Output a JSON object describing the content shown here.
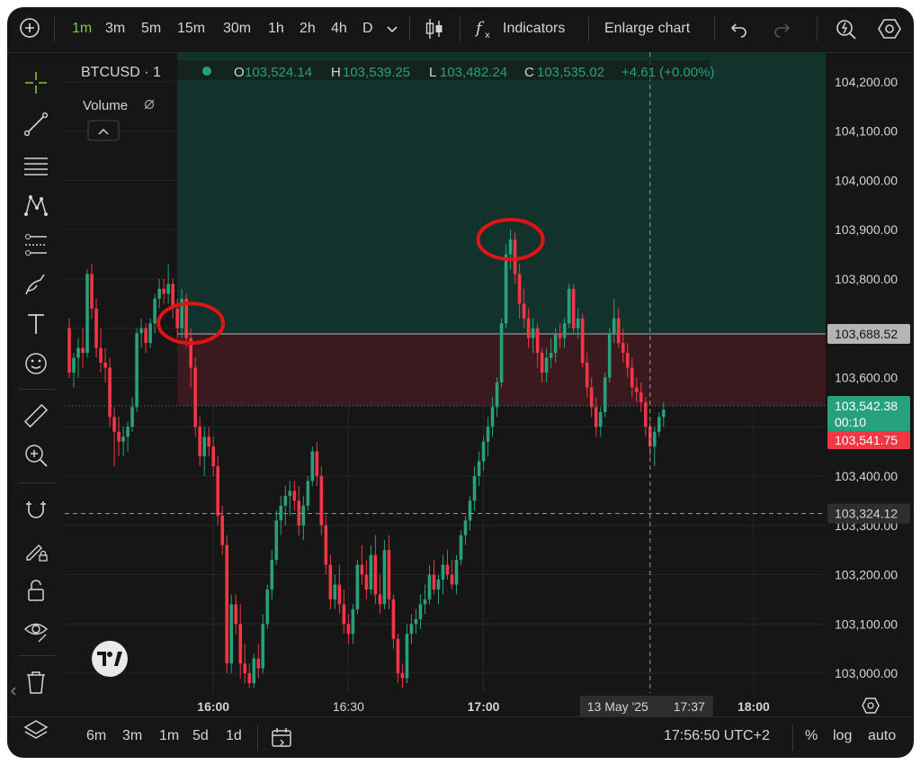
{
  "toolbar": {
    "timeframes": [
      "1m",
      "3m",
      "5m",
      "15m",
      "30m",
      "1h",
      "2h",
      "4h",
      "D"
    ],
    "active_timeframe": "1m",
    "indicators_label": "Indicators",
    "enlarge_label": "Enlarge chart"
  },
  "legend": {
    "symbol": "BTCUSD · 1",
    "o_label": "O",
    "o_value": "103,524.14",
    "h_label": "H",
    "h_value": "103,539.25",
    "l_label": "L",
    "l_value": "103,482.24",
    "c_label": "C",
    "c_value": "103,535.02",
    "change": "+4.61 (+0.00%)",
    "volume_label": "Volume"
  },
  "price_tags": {
    "position_line": "103,688.52",
    "last_price": "103,542.38",
    "countdown": "00:10",
    "bid": "103,541.75",
    "crosshair": "103,324.12",
    "crosshair_date": "13 May '25",
    "crosshair_time": "17:37"
  },
  "bottom": {
    "ranges": [
      "6m",
      "3m",
      "1m",
      "5d",
      "1d"
    ],
    "clock": "17:56:50 UTC+2",
    "percent": "%",
    "log": "log",
    "auto": "auto"
  },
  "colors": {
    "up": "#26a17b",
    "down": "#f23645",
    "accent": "#7ec83a",
    "profit_zone": "#12332b",
    "loss_zone": "#3a1a1f",
    "annotation": "#e01414"
  },
  "chart_data": {
    "type": "candlestick",
    "symbol": "BTCUSD",
    "interval": "1m",
    "ylim": [
      102960,
      104260
    ],
    "y_ticks": [
      103000,
      103100,
      103200,
      103300,
      103400,
      103500,
      103600,
      103700,
      103800,
      103900,
      104000,
      104100,
      104200
    ],
    "x_ticks": [
      {
        "label": "16:00",
        "minute": 960,
        "bold": true
      },
      {
        "label": "16:30",
        "minute": 990,
        "bold": false
      },
      {
        "label": "17:00",
        "minute": 1020,
        "bold": true
      },
      {
        "label": "18:00",
        "minute": 1080,
        "bold": true
      }
    ],
    "x_range_minutes": [
      927,
      1096
    ],
    "candles": [
      {
        "t": "15:28",
        "o": 103700,
        "h": 103720,
        "l": 103600,
        "c": 103610
      },
      {
        "t": "15:29",
        "o": 103610,
        "h": 103650,
        "l": 103580,
        "c": 103640
      },
      {
        "t": "15:30",
        "o": 103640,
        "h": 103680,
        "l": 103600,
        "c": 103660
      },
      {
        "t": "15:31",
        "o": 103660,
        "h": 103700,
        "l": 103620,
        "c": 103650
      },
      {
        "t": "15:32",
        "o": 103650,
        "h": 103820,
        "l": 103640,
        "c": 103810
      },
      {
        "t": "15:33",
        "o": 103810,
        "h": 103830,
        "l": 103720,
        "c": 103740
      },
      {
        "t": "15:34",
        "o": 103740,
        "h": 103760,
        "l": 103640,
        "c": 103660
      },
      {
        "t": "15:35",
        "o": 103660,
        "h": 103700,
        "l": 103610,
        "c": 103630
      },
      {
        "t": "15:36",
        "o": 103630,
        "h": 103660,
        "l": 103590,
        "c": 103620
      },
      {
        "t": "15:37",
        "o": 103620,
        "h": 103640,
        "l": 103500,
        "c": 103520
      },
      {
        "t": "15:38",
        "o": 103520,
        "h": 103540,
        "l": 103420,
        "c": 103490
      },
      {
        "t": "15:39",
        "o": 103490,
        "h": 103520,
        "l": 103440,
        "c": 103470
      },
      {
        "t": "15:40",
        "o": 103470,
        "h": 103500,
        "l": 103440,
        "c": 103480
      },
      {
        "t": "15:41",
        "o": 103480,
        "h": 103510,
        "l": 103450,
        "c": 103500
      },
      {
        "t": "15:42",
        "o": 103500,
        "h": 103560,
        "l": 103490,
        "c": 103540
      },
      {
        "t": "15:43",
        "o": 103540,
        "h": 103700,
        "l": 103530,
        "c": 103690
      },
      {
        "t": "15:44",
        "o": 103690,
        "h": 103720,
        "l": 103660,
        "c": 103700
      },
      {
        "t": "15:45",
        "o": 103700,
        "h": 103710,
        "l": 103650,
        "c": 103670
      },
      {
        "t": "15:46",
        "o": 103670,
        "h": 103720,
        "l": 103660,
        "c": 103710
      },
      {
        "t": "15:47",
        "o": 103710,
        "h": 103770,
        "l": 103690,
        "c": 103760
      },
      {
        "t": "15:48",
        "o": 103760,
        "h": 103800,
        "l": 103740,
        "c": 103780
      },
      {
        "t": "15:49",
        "o": 103780,
        "h": 103800,
        "l": 103750,
        "c": 103770
      },
      {
        "t": "15:50",
        "o": 103770,
        "h": 103830,
        "l": 103750,
        "c": 103790
      },
      {
        "t": "15:51",
        "o": 103790,
        "h": 103800,
        "l": 103720,
        "c": 103740
      },
      {
        "t": "15:52",
        "o": 103740,
        "h": 103760,
        "l": 103680,
        "c": 103700
      },
      {
        "t": "15:53",
        "o": 103700,
        "h": 103780,
        "l": 103680,
        "c": 103760
      },
      {
        "t": "15:54",
        "o": 103760,
        "h": 103770,
        "l": 103660,
        "c": 103680
      },
      {
        "t": "15:55",
        "o": 103680,
        "h": 103700,
        "l": 103580,
        "c": 103620
      },
      {
        "t": "15:56",
        "o": 103620,
        "h": 103640,
        "l": 103480,
        "c": 103500
      },
      {
        "t": "15:57",
        "o": 103500,
        "h": 103520,
        "l": 103420,
        "c": 103440
      },
      {
        "t": "15:58",
        "o": 103440,
        "h": 103500,
        "l": 103400,
        "c": 103480
      },
      {
        "t": "15:59",
        "o": 103480,
        "h": 103500,
        "l": 103440,
        "c": 103460
      },
      {
        "t": "16:00",
        "o": 103460,
        "h": 103480,
        "l": 103400,
        "c": 103420
      },
      {
        "t": "16:01",
        "o": 103420,
        "h": 103440,
        "l": 103300,
        "c": 103320
      },
      {
        "t": "16:02",
        "o": 103320,
        "h": 103340,
        "l": 103240,
        "c": 103260
      },
      {
        "t": "16:03",
        "o": 103260,
        "h": 103280,
        "l": 103000,
        "c": 103020
      },
      {
        "t": "16:04",
        "o": 103020,
        "h": 103160,
        "l": 103000,
        "c": 103140
      },
      {
        "t": "16:05",
        "o": 103140,
        "h": 103160,
        "l": 103080,
        "c": 103100
      },
      {
        "t": "16:06",
        "o": 103100,
        "h": 103140,
        "l": 102990,
        "c": 103020
      },
      {
        "t": "16:07",
        "o": 103020,
        "h": 103060,
        "l": 102980,
        "c": 103000
      },
      {
        "t": "16:08",
        "o": 103000,
        "h": 103020,
        "l": 102970,
        "c": 102980
      },
      {
        "t": "16:09",
        "o": 102980,
        "h": 103040,
        "l": 102970,
        "c": 103030
      },
      {
        "t": "16:10",
        "o": 103030,
        "h": 103060,
        "l": 102990,
        "c": 103010
      },
      {
        "t": "16:11",
        "o": 103010,
        "h": 103120,
        "l": 103000,
        "c": 103100
      },
      {
        "t": "16:12",
        "o": 103100,
        "h": 103180,
        "l": 103090,
        "c": 103170
      },
      {
        "t": "16:13",
        "o": 103170,
        "h": 103250,
        "l": 103150,
        "c": 103230
      },
      {
        "t": "16:14",
        "o": 103230,
        "h": 103330,
        "l": 103220,
        "c": 103310
      },
      {
        "t": "16:15",
        "o": 103310,
        "h": 103360,
        "l": 103280,
        "c": 103340
      },
      {
        "t": "16:16",
        "o": 103340,
        "h": 103380,
        "l": 103300,
        "c": 103360
      },
      {
        "t": "16:17",
        "o": 103360,
        "h": 103390,
        "l": 103320,
        "c": 103370
      },
      {
        "t": "16:18",
        "o": 103370,
        "h": 103390,
        "l": 103330,
        "c": 103350
      },
      {
        "t": "16:19",
        "o": 103350,
        "h": 103380,
        "l": 103280,
        "c": 103300
      },
      {
        "t": "16:20",
        "o": 103300,
        "h": 103360,
        "l": 103270,
        "c": 103340
      },
      {
        "t": "16:21",
        "o": 103340,
        "h": 103400,
        "l": 103330,
        "c": 103390
      },
      {
        "t": "16:22",
        "o": 103390,
        "h": 103460,
        "l": 103380,
        "c": 103450
      },
      {
        "t": "16:23",
        "o": 103450,
        "h": 103470,
        "l": 103380,
        "c": 103400
      },
      {
        "t": "16:24",
        "o": 103400,
        "h": 103420,
        "l": 103280,
        "c": 103300
      },
      {
        "t": "16:25",
        "o": 103300,
        "h": 103320,
        "l": 103200,
        "c": 103220
      },
      {
        "t": "16:26",
        "o": 103220,
        "h": 103240,
        "l": 103130,
        "c": 103150
      },
      {
        "t": "16:27",
        "o": 103150,
        "h": 103200,
        "l": 103130,
        "c": 103180
      },
      {
        "t": "16:28",
        "o": 103180,
        "h": 103220,
        "l": 103120,
        "c": 103140
      },
      {
        "t": "16:29",
        "o": 103140,
        "h": 103170,
        "l": 103080,
        "c": 103100
      },
      {
        "t": "16:30",
        "o": 103100,
        "h": 103120,
        "l": 103060,
        "c": 103080
      },
      {
        "t": "16:31",
        "o": 103080,
        "h": 103140,
        "l": 103060,
        "c": 103130
      },
      {
        "t": "16:32",
        "o": 103130,
        "h": 103230,
        "l": 103120,
        "c": 103220
      },
      {
        "t": "16:33",
        "o": 103220,
        "h": 103260,
        "l": 103180,
        "c": 103200
      },
      {
        "t": "16:34",
        "o": 103200,
        "h": 103230,
        "l": 103150,
        "c": 103170
      },
      {
        "t": "16:35",
        "o": 103170,
        "h": 103260,
        "l": 103160,
        "c": 103240
      },
      {
        "t": "16:36",
        "o": 103240,
        "h": 103280,
        "l": 103140,
        "c": 103160
      },
      {
        "t": "16:37",
        "o": 103160,
        "h": 103200,
        "l": 103120,
        "c": 103140
      },
      {
        "t": "16:38",
        "o": 103140,
        "h": 103270,
        "l": 103130,
        "c": 103250
      },
      {
        "t": "16:39",
        "o": 103250,
        "h": 103280,
        "l": 103130,
        "c": 103150
      },
      {
        "t": "16:40",
        "o": 103150,
        "h": 103160,
        "l": 103050,
        "c": 103070
      },
      {
        "t": "16:41",
        "o": 103070,
        "h": 103080,
        "l": 102980,
        "c": 103000
      },
      {
        "t": "16:42",
        "o": 103000,
        "h": 103020,
        "l": 102970,
        "c": 102990
      },
      {
        "t": "16:43",
        "o": 102990,
        "h": 103100,
        "l": 102980,
        "c": 103080
      },
      {
        "t": "16:44",
        "o": 103080,
        "h": 103120,
        "l": 103060,
        "c": 103100
      },
      {
        "t": "16:45",
        "o": 103100,
        "h": 103130,
        "l": 103080,
        "c": 103110
      },
      {
        "t": "16:46",
        "o": 103110,
        "h": 103160,
        "l": 103090,
        "c": 103140
      },
      {
        "t": "16:47",
        "o": 103140,
        "h": 103180,
        "l": 103120,
        "c": 103150
      },
      {
        "t": "16:48",
        "o": 103150,
        "h": 103220,
        "l": 103140,
        "c": 103200
      },
      {
        "t": "16:49",
        "o": 103200,
        "h": 103230,
        "l": 103160,
        "c": 103170
      },
      {
        "t": "16:50",
        "o": 103170,
        "h": 103200,
        "l": 103140,
        "c": 103190
      },
      {
        "t": "16:51",
        "o": 103190,
        "h": 103240,
        "l": 103160,
        "c": 103220
      },
      {
        "t": "16:52",
        "o": 103220,
        "h": 103250,
        "l": 103190,
        "c": 103200
      },
      {
        "t": "16:53",
        "o": 103200,
        "h": 103230,
        "l": 103170,
        "c": 103180
      },
      {
        "t": "16:54",
        "o": 103180,
        "h": 103240,
        "l": 103160,
        "c": 103230
      },
      {
        "t": "16:55",
        "o": 103230,
        "h": 103290,
        "l": 103220,
        "c": 103280
      },
      {
        "t": "16:56",
        "o": 103280,
        "h": 103320,
        "l": 103260,
        "c": 103310
      },
      {
        "t": "16:57",
        "o": 103310,
        "h": 103360,
        "l": 103290,
        "c": 103350
      },
      {
        "t": "16:58",
        "o": 103350,
        "h": 103420,
        "l": 103330,
        "c": 103400
      },
      {
        "t": "16:59",
        "o": 103400,
        "h": 103450,
        "l": 103380,
        "c": 103430
      },
      {
        "t": "17:00",
        "o": 103430,
        "h": 103480,
        "l": 103410,
        "c": 103470
      },
      {
        "t": "17:01",
        "o": 103470,
        "h": 103520,
        "l": 103440,
        "c": 103500
      },
      {
        "t": "17:02",
        "o": 103500,
        "h": 103560,
        "l": 103480,
        "c": 103540
      },
      {
        "t": "17:03",
        "o": 103540,
        "h": 103600,
        "l": 103520,
        "c": 103590
      },
      {
        "t": "17:04",
        "o": 103590,
        "h": 103720,
        "l": 103580,
        "c": 103710
      },
      {
        "t": "17:05",
        "o": 103710,
        "h": 103870,
        "l": 103700,
        "c": 103850
      },
      {
        "t": "17:06",
        "o": 103850,
        "h": 103900,
        "l": 103820,
        "c": 103880
      },
      {
        "t": "17:07",
        "o": 103880,
        "h": 103895,
        "l": 103790,
        "c": 103810
      },
      {
        "t": "17:08",
        "o": 103810,
        "h": 103830,
        "l": 103720,
        "c": 103750
      },
      {
        "t": "17:09",
        "o": 103750,
        "h": 103780,
        "l": 103700,
        "c": 103720
      },
      {
        "t": "17:10",
        "o": 103720,
        "h": 103740,
        "l": 103660,
        "c": 103680
      },
      {
        "t": "17:11",
        "o": 103680,
        "h": 103720,
        "l": 103650,
        "c": 103700
      },
      {
        "t": "17:12",
        "o": 103700,
        "h": 103710,
        "l": 103620,
        "c": 103650
      },
      {
        "t": "17:13",
        "o": 103650,
        "h": 103660,
        "l": 103590,
        "c": 103610
      },
      {
        "t": "17:14",
        "o": 103610,
        "h": 103660,
        "l": 103590,
        "c": 103640
      },
      {
        "t": "17:15",
        "o": 103640,
        "h": 103680,
        "l": 103620,
        "c": 103650
      },
      {
        "t": "17:16",
        "o": 103650,
        "h": 103700,
        "l": 103630,
        "c": 103690
      },
      {
        "t": "17:17",
        "o": 103690,
        "h": 103710,
        "l": 103660,
        "c": 103680
      },
      {
        "t": "17:18",
        "o": 103680,
        "h": 103720,
        "l": 103660,
        "c": 103710
      },
      {
        "t": "17:19",
        "o": 103710,
        "h": 103790,
        "l": 103700,
        "c": 103780
      },
      {
        "t": "17:20",
        "o": 103780,
        "h": 103790,
        "l": 103690,
        "c": 103700
      },
      {
        "t": "17:21",
        "o": 103700,
        "h": 103740,
        "l": 103680,
        "c": 103720
      },
      {
        "t": "17:22",
        "o": 103720,
        "h": 103730,
        "l": 103620,
        "c": 103630
      },
      {
        "t": "17:23",
        "o": 103630,
        "h": 103650,
        "l": 103560,
        "c": 103580
      },
      {
        "t": "17:24",
        "o": 103580,
        "h": 103600,
        "l": 103520,
        "c": 103540
      },
      {
        "t": "17:25",
        "o": 103540,
        "h": 103560,
        "l": 103480,
        "c": 103500
      },
      {
        "t": "17:26",
        "o": 103500,
        "h": 103540,
        "l": 103480,
        "c": 103530
      },
      {
        "t": "17:27",
        "o": 103530,
        "h": 103610,
        "l": 103520,
        "c": 103600
      },
      {
        "t": "17:28",
        "o": 103600,
        "h": 103700,
        "l": 103590,
        "c": 103690
      },
      {
        "t": "17:29",
        "o": 103690,
        "h": 103760,
        "l": 103670,
        "c": 103720
      },
      {
        "t": "17:30",
        "o": 103720,
        "h": 103740,
        "l": 103660,
        "c": 103670
      },
      {
        "t": "17:31",
        "o": 103670,
        "h": 103700,
        "l": 103630,
        "c": 103650
      },
      {
        "t": "17:32",
        "o": 103650,
        "h": 103670,
        "l": 103600,
        "c": 103620
      },
      {
        "t": "17:33",
        "o": 103620,
        "h": 103640,
        "l": 103560,
        "c": 103580
      },
      {
        "t": "17:34",
        "o": 103580,
        "h": 103600,
        "l": 103550,
        "c": 103570
      },
      {
        "t": "17:35",
        "o": 103570,
        "h": 103590,
        "l": 103530,
        "c": 103550
      },
      {
        "t": "17:36",
        "o": 103550,
        "h": 103560,
        "l": 103480,
        "c": 103500
      },
      {
        "t": "17:37",
        "o": 103500,
        "h": 103510,
        "l": 103440,
        "c": 103460
      },
      {
        "t": "17:38",
        "o": 103460,
        "h": 103500,
        "l": 103420,
        "c": 103490
      },
      {
        "t": "17:39",
        "o": 103490,
        "h": 103530,
        "l": 103480,
        "c": 103520
      },
      {
        "t": "17:40",
        "o": 103520,
        "h": 103550,
        "l": 103500,
        "c": 103535
      }
    ],
    "annotations": [
      {
        "type": "ellipse",
        "minute": 955,
        "price": 103710
      },
      {
        "type": "ellipse",
        "minute": 1026,
        "price": 103880
      }
    ],
    "position": {
      "entry": 103542.38,
      "target": 104260,
      "stop": 103688.52,
      "start_minute": 952
    },
    "crosshair": {
      "minute": 1057,
      "price": 103324.12
    },
    "last_price": 103542.38
  }
}
